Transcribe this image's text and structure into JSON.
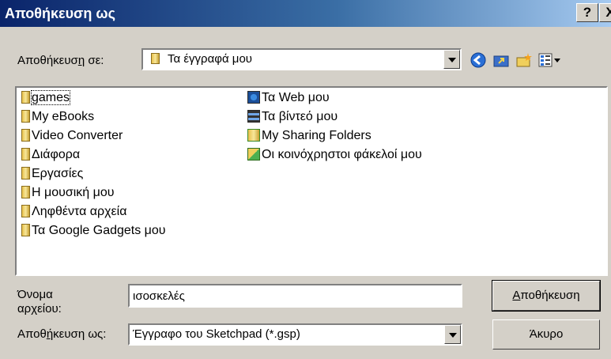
{
  "window": {
    "title": "Αποθήκευση ως",
    "help_button": "?",
    "close_button": "X"
  },
  "save_in": {
    "label_prefix": "Αποθήκευσ",
    "label_hotkey": "η",
    "label_suffix": " σε:",
    "value": "Τα έγγραφά μου"
  },
  "toolbar": {
    "back_icon": "back-icon",
    "up_folder_icon": "up-folder-icon",
    "new_folder_icon": "new-folder-icon",
    "view_menu_icon": "view-menu-icon"
  },
  "file_list": {
    "column1": [
      "games",
      "My eBooks",
      "Video Converter",
      "Διάφορα",
      "Εργασίες",
      "Η μουσική μου",
      "Ληφθέντα αρχεία",
      "Τα Google Gadgets μου"
    ],
    "column2": [
      "Τα Web μου",
      "Τα βίντεό μου",
      "My Sharing Folders",
      "Οι κοινόχρηστοι φάκελοί μου"
    ]
  },
  "filename": {
    "label_line1": "Όνομα",
    "label_line2_prefix": "αρ",
    "label_line2_hotkey": "χ",
    "label_line2_suffix": "είου:",
    "value": "ισοσκελές"
  },
  "file_type": {
    "label_prefix": "Αποθ",
    "label_hotkey": "ή",
    "label_suffix": "κευση ως:",
    "value": "Έγγραφο του Sketchpad (*.gsp)"
  },
  "buttons": {
    "save_hotkey": "Α",
    "save_rest": "ποθήκευση",
    "cancel": "Άκυρο"
  }
}
